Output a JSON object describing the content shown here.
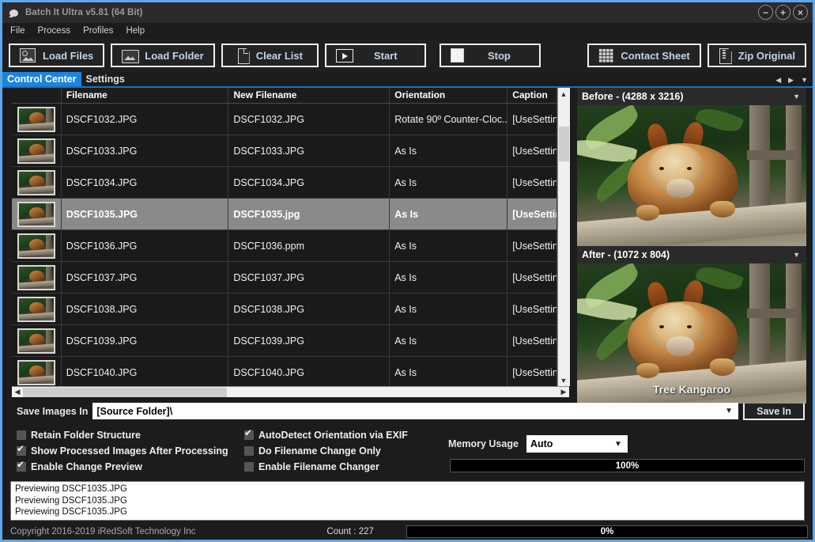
{
  "window": {
    "title": "Batch It Ultra v5.81 (64 Bit)",
    "icon": "app-icon",
    "controls": [
      {
        "name": "minimize-button",
        "glyph": "−"
      },
      {
        "name": "maximize-button",
        "glyph": "+"
      },
      {
        "name": "close-button",
        "glyph": "×"
      }
    ]
  },
  "menu": [
    "File",
    "Process",
    "Profiles",
    "Help"
  ],
  "toolbar": [
    {
      "label": "Load Files",
      "icon": "load-files-icon"
    },
    {
      "label": "Load Folder",
      "icon": "load-folder-icon"
    },
    {
      "label": "Clear List",
      "icon": "clear-list-icon"
    },
    {
      "label": "Start",
      "icon": "play-icon"
    },
    {
      "label": "Stop",
      "icon": "stop-icon"
    },
    {
      "label": "Contact Sheet",
      "icon": "contact-sheet-icon"
    },
    {
      "label": "Zip Original",
      "icon": "zip-icon"
    }
  ],
  "tabs": [
    {
      "label": "Control Center",
      "active": true
    },
    {
      "label": "Settings",
      "active": false
    }
  ],
  "table": {
    "columns": [
      "",
      "Filename",
      "New Filename",
      "Orientation",
      "Caption"
    ],
    "rows": [
      {
        "filename": "DSCF1032.JPG",
        "new_filename": "DSCF1032.JPG",
        "orientation": "Rotate 90º Counter-Cloc...",
        "caption": "[UseSettin",
        "selected": false
      },
      {
        "filename": "DSCF1033.JPG",
        "new_filename": "DSCF1033.JPG",
        "orientation": "As Is",
        "caption": "[UseSettin",
        "selected": false
      },
      {
        "filename": "DSCF1034.JPG",
        "new_filename": "DSCF1034.JPG",
        "orientation": "As Is",
        "caption": "[UseSettin",
        "selected": false
      },
      {
        "filename": "DSCF1035.JPG",
        "new_filename": "DSCF1035.jpg",
        "orientation": "As Is",
        "caption": "[UseSettin",
        "selected": true
      },
      {
        "filename": "DSCF1036.JPG",
        "new_filename": "DSCF1036.ppm",
        "orientation": "As Is",
        "caption": "[UseSettin",
        "selected": false
      },
      {
        "filename": "DSCF1037.JPG",
        "new_filename": "DSCF1037.JPG",
        "orientation": "As Is",
        "caption": "[UseSettin",
        "selected": false
      },
      {
        "filename": "DSCF1038.JPG",
        "new_filename": "DSCF1038.JPG",
        "orientation": "As Is",
        "caption": "[UseSettin",
        "selected": false
      },
      {
        "filename": "DSCF1039.JPG",
        "new_filename": "DSCF1039.JPG",
        "orientation": "As Is",
        "caption": "[UseSettin",
        "selected": false
      },
      {
        "filename": "DSCF1040.JPG",
        "new_filename": "DSCF1040.JPG",
        "orientation": "As Is",
        "caption": "[UseSettin",
        "selected": false
      }
    ]
  },
  "preview": {
    "before": {
      "title": "Before - (4288 x 3216)"
    },
    "after": {
      "title": "After - (1072 x 804)",
      "overlay_caption": "Tree Kangaroo"
    }
  },
  "options": {
    "save_label": "Save Images In",
    "save_path": "[Source Folder]\\",
    "save_in_button": "Save In",
    "checkboxes_left": [
      {
        "label": "Retain Folder Structure",
        "checked": false
      },
      {
        "label": "Show Processed Images After Processing",
        "checked": true
      },
      {
        "label": "Enable Change Preview",
        "checked": true
      }
    ],
    "checkboxes_right": [
      {
        "label": "AutoDetect Orientation via EXIF",
        "checked": true
      },
      {
        "label": "Do Filename Change Only",
        "checked": false
      },
      {
        "label": "Enable Filename Changer",
        "checked": false
      }
    ],
    "memory_label": "Memory Usage",
    "memory_value": "Auto",
    "memory_progress": "100%"
  },
  "log": [
    "Previewing DSCF1035.JPG",
    "Previewing DSCF1035.JPG",
    "Previewing DSCF1035.JPG"
  ],
  "status": {
    "copyright": "Copyright 2016-2019 iRedSoft Technology Inc",
    "count": "Count : 227",
    "progress": "0%"
  },
  "colors": {
    "accent": "#1c84e0",
    "window_border": "#5ca8e8",
    "background": "#1c1c1c",
    "selection": "#8a8a8a"
  }
}
